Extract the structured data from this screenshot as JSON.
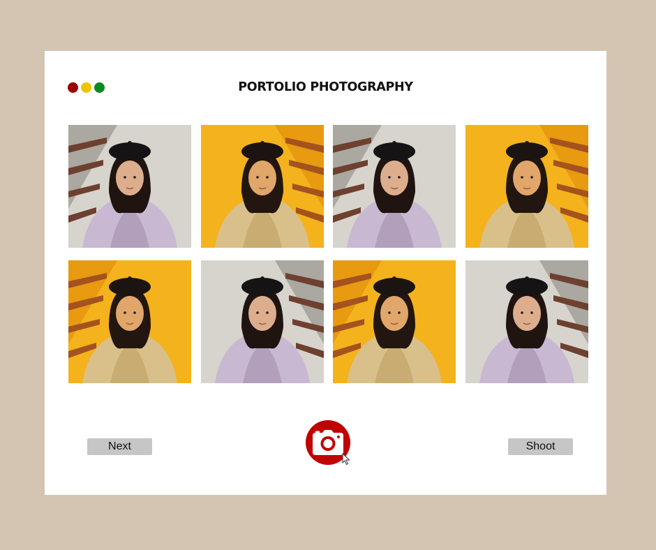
{
  "window": {
    "title": "PORTOLIO PHOTOGRAPHY",
    "dots": [
      {
        "name": "close",
        "color": "#9e0000"
      },
      {
        "name": "minimize",
        "color": "#f0c400"
      },
      {
        "name": "maximize",
        "color": "#0b8a1f"
      }
    ]
  },
  "photos": [
    {
      "name": "photo-1",
      "tone": "neutral"
    },
    {
      "name": "photo-2",
      "tone": "amber"
    },
    {
      "name": "photo-3",
      "tone": "neutral"
    },
    {
      "name": "photo-4",
      "tone": "amber"
    },
    {
      "name": "photo-5",
      "tone": "amber"
    },
    {
      "name": "photo-6",
      "tone": "neutral"
    },
    {
      "name": "photo-7",
      "tone": "amber"
    },
    {
      "name": "photo-8",
      "tone": "neutral"
    }
  ],
  "controls": {
    "next_label": "Next",
    "shoot_label": "Shoot",
    "shutter_icon": "camera-icon",
    "shutter_color": "#c10000"
  }
}
